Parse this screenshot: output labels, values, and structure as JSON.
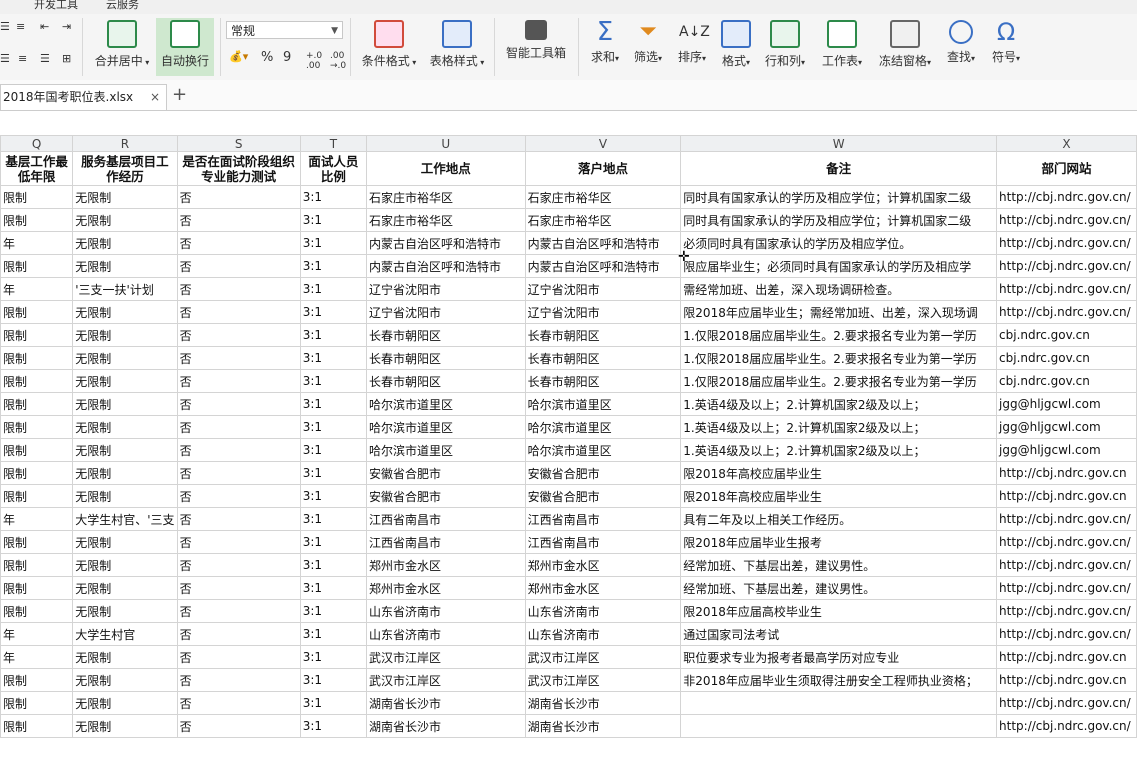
{
  "menubar": {
    "tabs": [
      "开发工具",
      "云服务"
    ]
  },
  "ribbon": {
    "merge_center": "合并居中",
    "wrap_text": "自动换行",
    "number_format": "常规",
    "percent": "%",
    "comma": "9",
    "conditional_format": "条件格式",
    "table_style": "表格样式",
    "smart_toolbox": "智能工具箱",
    "sum": "求和",
    "filter": "筛选",
    "sort": "排序",
    "format": "格式",
    "rows_cols": "行和列",
    "worksheet": "工作表",
    "freeze": "冻结窗格",
    "find": "查找",
    "symbol": "符号"
  },
  "file_tab": {
    "name": "2018年国考职位表.xlsx",
    "close": "×",
    "new": "+"
  },
  "columns": [
    "Q",
    "R",
    "S",
    "T",
    "U",
    "V",
    "W",
    "X"
  ],
  "headers": [
    "基层工作最低年限",
    "服务基层项目工作经历",
    "是否在面试阶段组织专业能力测试",
    "面试人员比例",
    "工作地点",
    "落户地点",
    "备注",
    "部门网站"
  ],
  "rows": [
    [
      "限制",
      "无限制",
      "否",
      "3:1",
      "石家庄市裕华区",
      "石家庄市裕华区",
      "同时具有国家承认的学历及相应学位；计算机国家二级",
      "http://cbj.ndrc.gov.cn/"
    ],
    [
      "限制",
      "无限制",
      "否",
      "3:1",
      "石家庄市裕华区",
      "石家庄市裕华区",
      "同时具有国家承认的学历及相应学位；计算机国家二级",
      "http://cbj.ndrc.gov.cn/"
    ],
    [
      "年",
      "无限制",
      "否",
      "3:1",
      "内蒙古自治区呼和浩特市",
      "内蒙古自治区呼和浩特市",
      "必须同时具有国家承认的学历及相应学位。",
      "http://cbj.ndrc.gov.cn/"
    ],
    [
      "限制",
      "无限制",
      "否",
      "3:1",
      "内蒙古自治区呼和浩特市",
      "内蒙古自治区呼和浩特市",
      "限应届毕业生；必须同时具有国家承认的学历及相应学",
      "http://cbj.ndrc.gov.cn/"
    ],
    [
      "年",
      "'三支一扶'计划",
      "否",
      "3:1",
      "辽宁省沈阳市",
      "辽宁省沈阳市",
      "需经常加班、出差，深入现场调研检查。",
      "http://cbj.ndrc.gov.cn/"
    ],
    [
      "限制",
      "无限制",
      "否",
      "3:1",
      "辽宁省沈阳市",
      "辽宁省沈阳市",
      "限2018年应届毕业生；需经常加班、出差，深入现场调",
      "http://cbj.ndrc.gov.cn/"
    ],
    [
      "限制",
      "无限制",
      "否",
      "3:1",
      "长春市朝阳区",
      "长春市朝阳区",
      "1.仅限2018届应届毕业生。2.要求报名专业为第一学历",
      "cbj.ndrc.gov.cn"
    ],
    [
      "限制",
      "无限制",
      "否",
      "3:1",
      "长春市朝阳区",
      "长春市朝阳区",
      "1.仅限2018届应届毕业生。2.要求报名专业为第一学历",
      "cbj.ndrc.gov.cn"
    ],
    [
      "限制",
      "无限制",
      "否",
      "3:1",
      "长春市朝阳区",
      "长春市朝阳区",
      "1.仅限2018届应届毕业生。2.要求报名专业为第一学历",
      "cbj.ndrc.gov.cn"
    ],
    [
      "限制",
      "无限制",
      "否",
      "3:1",
      "哈尔滨市道里区",
      "哈尔滨市道里区",
      "1.英语4级及以上；2.计算机国家2级及以上；",
      "jgg@hljgcwl.com"
    ],
    [
      "限制",
      "无限制",
      "否",
      "3:1",
      "哈尔滨市道里区",
      "哈尔滨市道里区",
      "1.英语4级及以上；2.计算机国家2级及以上；",
      "jgg@hljgcwl.com"
    ],
    [
      "限制",
      "无限制",
      "否",
      "3:1",
      "哈尔滨市道里区",
      "哈尔滨市道里区",
      "1.英语4级及以上；2.计算机国家2级及以上；",
      "jgg@hljgcwl.com"
    ],
    [
      "限制",
      "无限制",
      "否",
      "3:1",
      "安徽省合肥市",
      "安徽省合肥市",
      "限2018年高校应届毕业生",
      "http://cbj.ndrc.gov.cn"
    ],
    [
      "限制",
      "无限制",
      "否",
      "3:1",
      "安徽省合肥市",
      "安徽省合肥市",
      "限2018年高校应届毕业生",
      "http://cbj.ndrc.gov.cn"
    ],
    [
      "年",
      "大学生村官、'三支",
      "否",
      "3:1",
      "江西省南昌市",
      "江西省南昌市",
      "具有二年及以上相关工作经历。",
      "http://cbj.ndrc.gov.cn/"
    ],
    [
      "限制",
      "无限制",
      "否",
      "3:1",
      "江西省南昌市",
      "江西省南昌市",
      "限2018年应届毕业生报考",
      "http://cbj.ndrc.gov.cn/"
    ],
    [
      "限制",
      "无限制",
      "否",
      "3:1",
      "郑州市金水区",
      "郑州市金水区",
      "经常加班、下基层出差，建议男性。",
      "http://cbj.ndrc.gov.cn/"
    ],
    [
      "限制",
      "无限制",
      "否",
      "3:1",
      "郑州市金水区",
      "郑州市金水区",
      "经常加班、下基层出差，建议男性。",
      "http://cbj.ndrc.gov.cn/"
    ],
    [
      "限制",
      "无限制",
      "否",
      "3:1",
      "山东省济南市",
      "山东省济南市",
      "限2018年应届高校毕业生",
      "http://cbj.ndrc.gov.cn/"
    ],
    [
      "年",
      "大学生村官",
      "否",
      "3:1",
      "山东省济南市",
      "山东省济南市",
      "通过国家司法考试",
      "http://cbj.ndrc.gov.cn/"
    ],
    [
      "年",
      "无限制",
      "否",
      "3:1",
      "武汉市江岸区",
      "武汉市江岸区",
      "职位要求专业为报考者最高学历对应专业",
      "http://cbj.ndrc.gov.cn"
    ],
    [
      "限制",
      "无限制",
      "否",
      "3:1",
      "武汉市江岸区",
      "武汉市江岸区",
      "非2018年应届毕业生须取得注册安全工程师执业资格；",
      "http://cbj.ndrc.gov.cn"
    ],
    [
      "限制",
      "无限制",
      "否",
      "3:1",
      "湖南省长沙市",
      "湖南省长沙市",
      "",
      "http://cbj.ndrc.gov.cn/"
    ],
    [
      "限制",
      "无限制",
      "否",
      "3:1",
      "湖南省长沙市",
      "湖南省长沙市",
      "",
      "http://cbj.ndrc.gov.cn/"
    ]
  ]
}
